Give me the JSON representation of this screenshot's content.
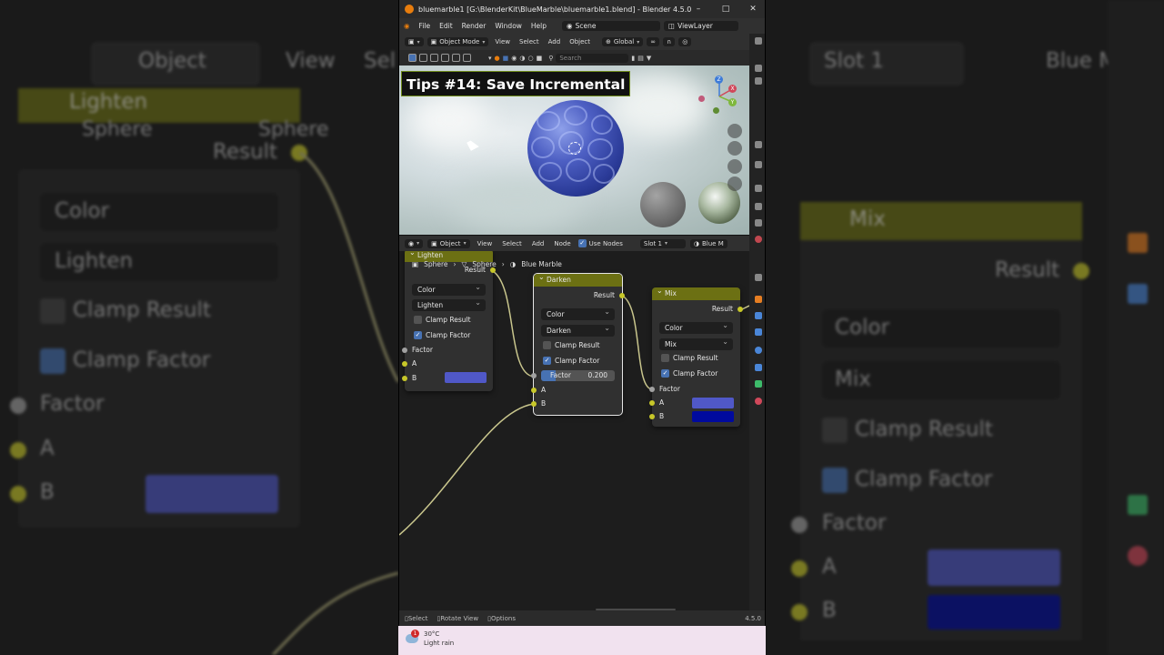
{
  "window": {
    "title": "bluemarble1 [G:\\BlenderKit\\BlueMarble\\bluemarble1.blend] - Blender 4.5.0",
    "min": "–",
    "max": "□",
    "close": "✕"
  },
  "menubar": {
    "items": [
      "File",
      "Edit",
      "Render",
      "Window",
      "Help"
    ],
    "scene": "Scene",
    "view_layer": "ViewLayer"
  },
  "viewport_header": {
    "mode": "Object Mode",
    "menus": [
      "View",
      "Select",
      "Add",
      "Object"
    ],
    "transform": "Global"
  },
  "viewport_tools": {
    "search_placeholder": "Search"
  },
  "overlay": {
    "tips": "Tips #14: Save Incremental"
  },
  "gizmo": {
    "z": "Z",
    "y": "Y",
    "x": "X"
  },
  "node_header": {
    "editor": "Object",
    "menus": [
      "View",
      "Select",
      "Add",
      "Node"
    ],
    "use_nodes": "Use Nodes",
    "slot": "Slot 1",
    "material": "Blue M"
  },
  "breadcrumb": {
    "items": [
      "Sphere",
      "Sphere",
      "Blue Marble"
    ]
  },
  "nodes": {
    "lighten": {
      "title": "Lighten",
      "result": "Result",
      "data_type": "Color",
      "blend": "Lighten",
      "clamp_result": "Clamp Result",
      "clamp_factor": "Clamp Factor",
      "factor": "Factor",
      "a": "A",
      "b": "B"
    },
    "darken": {
      "title": "Darken",
      "result": "Result",
      "data_type": "Color",
      "blend": "Darken",
      "clamp_result": "Clamp Result",
      "clamp_factor": "Clamp Factor",
      "factor": "Factor",
      "factor_value": "0.200",
      "factor_fraction": 0.2,
      "a": "A",
      "b": "B"
    },
    "mix": {
      "title": "Mix",
      "result": "Result",
      "data_type": "Color",
      "blend": "Mix",
      "clamp_result": "Clamp Result",
      "clamp_factor": "Clamp Factor",
      "factor": "Factor",
      "a": "A",
      "b": "B"
    }
  },
  "colors": {
    "node_header": "#6c7013",
    "socket_color": "#c7c729",
    "socket_float": "#a1a1a1",
    "swatch_purple": "#5058c8",
    "swatch_navy": "#000a9e",
    "selection": "#4772b3"
  },
  "statusbar": {
    "select": "Select",
    "rotate": "Rotate View",
    "options": "Options",
    "version": "4.5.0"
  },
  "taskbar": {
    "temp": "30°C",
    "condition": "Light rain",
    "badge": "1"
  },
  "background": {
    "left": {
      "object": "Object",
      "view": "View",
      "sel": "Sel",
      "lighten": "Lighten",
      "sphere1": "Sphere",
      "sphere2": "Sphere",
      "result": "Result",
      "color": "Color",
      "blend": "Lighten",
      "clamp_result": "Clamp Result",
      "clamp_factor": "Clamp Factor",
      "factor": "Factor",
      "a": "A",
      "b": "B"
    },
    "right": {
      "slot": "Slot 1",
      "material": "Blue M",
      "mix": "Mix",
      "result": "Result",
      "color": "Color",
      "blend": "Mix",
      "clamp_result": "Clamp Result",
      "clamp_factor": "Clamp Factor",
      "factor": "Factor",
      "a": "A",
      "b": "B"
    }
  }
}
